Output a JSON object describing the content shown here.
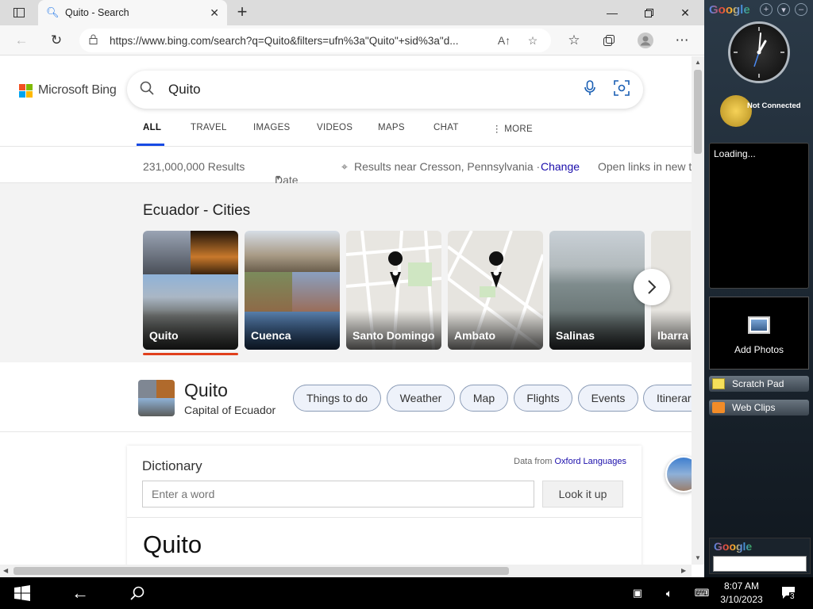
{
  "browser": {
    "tab_title": "Quito - Search",
    "url": "https://www.bing.com/search?q=Quito&filters=ufn%3a\"Quito\"+sid%3a\"d..."
  },
  "bing": {
    "logo_text": "Microsoft Bing",
    "query": "Quito",
    "scopes": [
      "ALL",
      "TRAVEL",
      "IMAGES",
      "VIDEOS",
      "MAPS",
      "CHAT",
      "MORE"
    ],
    "active_scope": "ALL",
    "results_count": "231,000,000 Results",
    "date_filter": "Date",
    "location_text": "Results near Cresson, Pennsylvania ·",
    "change_link": "Change",
    "open_links": "Open links in new t"
  },
  "carousel": {
    "title": "Ecuador - Cities",
    "cards": [
      "Quito",
      "Cuenca",
      "Santo Domingo",
      "Ambato",
      "Salinas",
      "Ibarra"
    ],
    "selected": "Quito"
  },
  "entity": {
    "name": "Quito",
    "subtitle": "Capital of Ecuador",
    "pills": [
      "Things to do",
      "Weather",
      "Map",
      "Flights",
      "Events",
      "Itinerar"
    ]
  },
  "dictionary": {
    "title": "Dictionary",
    "source_prefix": "Data from",
    "source_name": "Oxford Languages",
    "input_placeholder": "Enter a word",
    "button": "Look it up",
    "word": "Quito"
  },
  "sidebar": {
    "logo": "Google",
    "weather_status": "Not Connected",
    "loading": "Loading...",
    "add_photos": "Add Photos",
    "scratch_pad": "Scratch Pad",
    "web_clips": "Web Clips",
    "search_logo": "Google"
  },
  "taskbar": {
    "time": "8:07 AM",
    "date": "3/10/2023",
    "notification_count": "3"
  },
  "colors": {
    "bing_accent": "#174ae4",
    "selected_card_underline": "#e0401c",
    "link": "#1a0dab"
  }
}
